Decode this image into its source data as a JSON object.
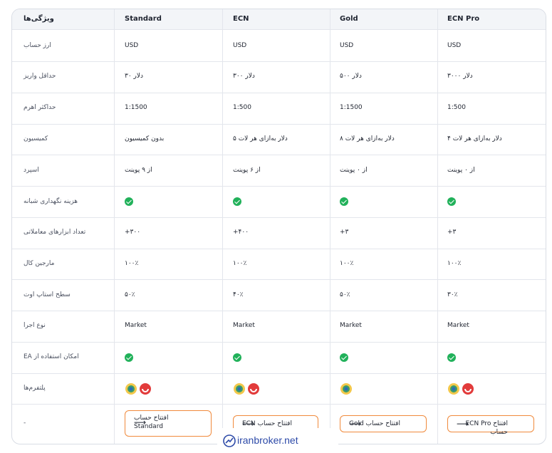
{
  "columns": {
    "feature": "ویژگی‌ها",
    "standard": "Standard",
    "ecn": "ECN",
    "gold": "Gold",
    "ecn_pro": "ECN Pro"
  },
  "rows": [
    {
      "label": "ارز حساب",
      "standard": "USD",
      "ecn": "USD",
      "gold": "USD",
      "ecn_pro": "USD"
    },
    {
      "label": "حداقل واریز",
      "standard": "دلار ۳۰",
      "ecn": "دلار ۳۰۰",
      "gold": "دلار ۵۰۰",
      "ecn_pro": "دلار ۳۰۰۰"
    },
    {
      "label": "حداکثر اهرم",
      "standard": "1:1500",
      "ecn": "1:500",
      "gold": "1:1500",
      "ecn_pro": "1:500"
    },
    {
      "label": "کمیسیون",
      "standard": "بدون کمیسیون",
      "ecn": "دلار به‌ازای هر لات ۵",
      "gold": "دلار به‌ازای هر لات ۸",
      "ecn_pro": "دلار به‌ازای هر لات ۴"
    },
    {
      "label": "اسپرد",
      "standard": "از ۹ پوینت",
      "ecn": "از ۶ پوینت",
      "gold": "از ۰ پوینت",
      "ecn_pro": "از ۰ پوینت"
    },
    {
      "label": "هزینه نگهداری شبانه",
      "standard": "",
      "ecn": "",
      "gold": "",
      "ecn_pro": ""
    },
    {
      "label": "تعداد ابزارهای معاملاتی",
      "standard": "+۳۰۰",
      "ecn": "+۴۰۰",
      "gold": "+۳",
      "ecn_pro": "+۳"
    },
    {
      "label": "مارجین کال",
      "standard": "۱۰۰٪",
      "ecn": "۱۰۰٪",
      "gold": "۱۰۰٪",
      "ecn_pro": "۱۰۰٪"
    },
    {
      "label": "سطح استاپ اوت",
      "standard": "۵۰٪",
      "ecn": "۴۰٪",
      "gold": "۵۰٪",
      "ecn_pro": "۳۰٪"
    },
    {
      "label": "نوع اجرا",
      "standard": "Market",
      "ecn": "Market",
      "gold": "Market",
      "ecn_pro": "Market"
    },
    {
      "label": "EA امکان استفاده از",
      "standard": "",
      "ecn": "",
      "gold": "",
      "ecn_pro": ""
    },
    {
      "label": "پلتفرم‌ها",
      "standard": "",
      "ecn": "",
      "gold": "",
      "ecn_pro": ""
    },
    {
      "label": "-",
      "standard": "",
      "ecn": "",
      "gold": "",
      "ecn_pro": ""
    }
  ],
  "buttons": {
    "standard": {
      "line1": "افتتاح حساب",
      "line2": "Standard"
    },
    "ecn": "ECN افتتاح حساب",
    "gold": "Gold افتتاح حساب",
    "ecn_pro": "ECN Pro افتتاح حساب",
    "arrow": "⟶"
  },
  "icons": {
    "check": "check-circle-icon",
    "platform_a": "metatrader-4-icon",
    "platform_b": "metatrader-5-icon",
    "check_color": "#21b15a",
    "button_border": "#f08a3c"
  },
  "watermark": "iranbroker.net"
}
